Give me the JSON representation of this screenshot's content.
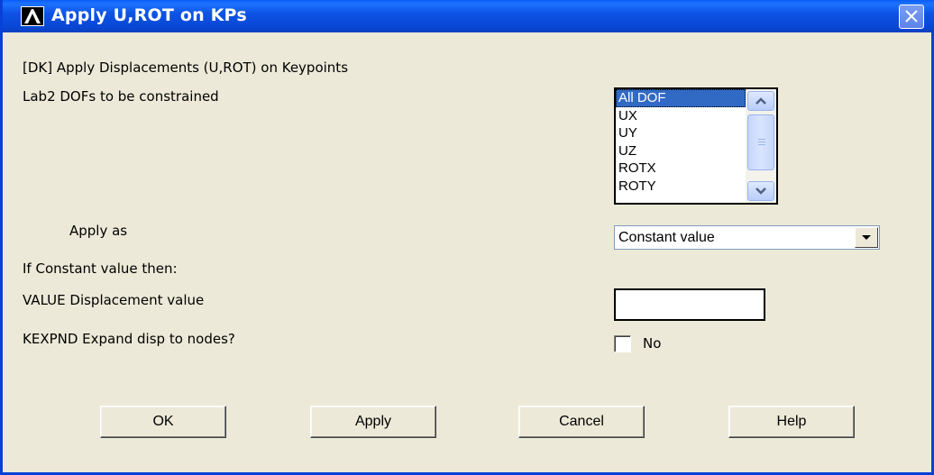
{
  "window": {
    "title": "Apply U,ROT on KPs",
    "close_icon": "close-icon",
    "colors": {
      "titlebar": "#0A5EF8",
      "body": "#ECE9D8",
      "selection": "#316AC5"
    }
  },
  "header": "[DK]  Apply Displacements (U,ROT) on Keypoints",
  "lab2": {
    "label": "Lab2    DOFs to be constrained",
    "options": [
      "All DOF",
      "UX",
      "UY",
      "UZ",
      "ROTX",
      "ROTY"
    ],
    "selected": "All DOF"
  },
  "apply_as": {
    "label": "Apply as",
    "value": "Constant value"
  },
  "constant_note": "If Constant value then:",
  "value_field": {
    "label": "VALUE   Displacement value",
    "value": ""
  },
  "kexpnd": {
    "label": "KEXPND  Expand disp to nodes?",
    "checkbox_label": "No",
    "checked": false
  },
  "buttons": {
    "ok": "OK",
    "apply": "Apply",
    "cancel": "Cancel",
    "help": "Help"
  }
}
